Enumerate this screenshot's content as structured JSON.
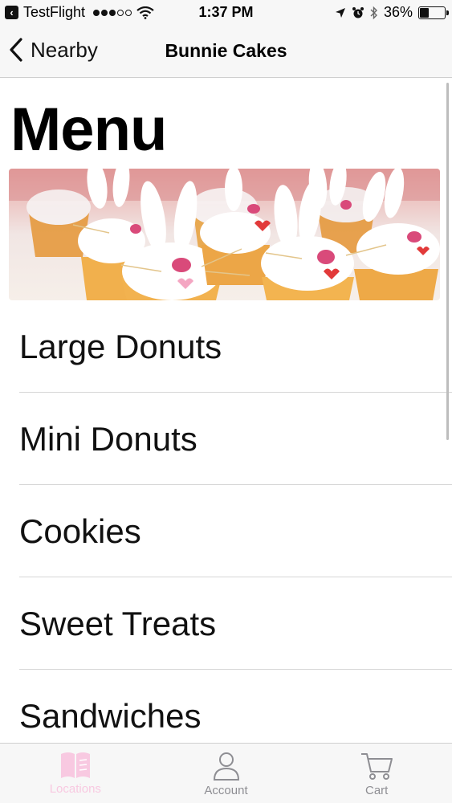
{
  "status_bar": {
    "back_app": "TestFlight",
    "time": "1:37 PM",
    "battery": "36%",
    "battery_level": 0.36
  },
  "nav": {
    "back_label": "Nearby",
    "title": "Bunnie Cakes"
  },
  "page": {
    "title": "Menu",
    "hero_image": "bunny cupcakes photo"
  },
  "menu": {
    "items": [
      {
        "label": "Large Donuts"
      },
      {
        "label": "Mini Donuts"
      },
      {
        "label": "Cookies"
      },
      {
        "label": "Sweet Treats"
      },
      {
        "label": "Sandwiches"
      }
    ]
  },
  "tabs": [
    {
      "label": "Locations",
      "icon": "book-icon",
      "active": true
    },
    {
      "label": "Account",
      "icon": "person-icon",
      "active": false
    },
    {
      "label": "Cart",
      "icon": "cart-icon",
      "active": false
    }
  ],
  "colors": {
    "accent": "#f8c9e1",
    "inactive": "#8e8e93",
    "bar_background": "#f7f7f7"
  }
}
